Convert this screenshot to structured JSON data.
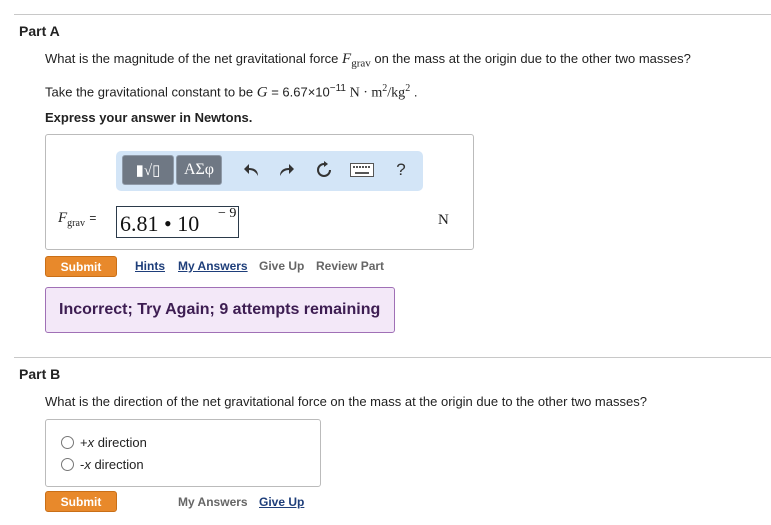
{
  "partA": {
    "title": "Part A",
    "question_before": "What is the magnitude of the net gravitational force ",
    "force_symbol": "F",
    "force_subscript": "grav",
    "question_after": " on the mass at the origin due to the other two masses?",
    "constant_before": "Take the gravitational constant to be ",
    "constant_symbol": "G",
    "constant_value": " = 6.67×10",
    "constant_exponent": "−11",
    "constant_units": "N · m",
    "constant_units_exp": "2",
    "constant_units_div": "/kg",
    "constant_units_div_exp": "2",
    "constant_end": ".",
    "instruction": "Express your answer in Newtons.",
    "toolbar": {
      "template_label": "▮√▯",
      "greek_label": "ΑΣφ",
      "help_label": "?"
    },
    "answer": {
      "label_symbol": "F",
      "label_subscript": "grav",
      "label_equals": "=",
      "mantissa": "6.81 • 10",
      "exponent": "− 9",
      "unit": "N"
    },
    "actions": {
      "submit": "Submit",
      "hints": "Hints",
      "my_answers": "My Answers",
      "give_up": "Give Up",
      "review_part": "Review Part"
    },
    "feedback": "Incorrect; Try Again; 9 attempts remaining"
  },
  "partB": {
    "title": "Part B",
    "question": "What is the direction of the net gravitational force on the mass at the origin due to the other two masses?",
    "choices": [
      {
        "prefix": "+",
        "var": "x",
        "suffix": " direction"
      },
      {
        "prefix": "-",
        "var": "x",
        "suffix": " direction"
      }
    ],
    "actions": {
      "submit": "Submit",
      "my_answers": "My Answers",
      "give_up": "Give Up"
    }
  },
  "colors": {
    "submit": "#e8892b",
    "toolbar": "#d3e5f7",
    "feedback_bg": "#f3e8f8",
    "feedback_border": "#a070b6",
    "link": "#1e3e7a"
  }
}
